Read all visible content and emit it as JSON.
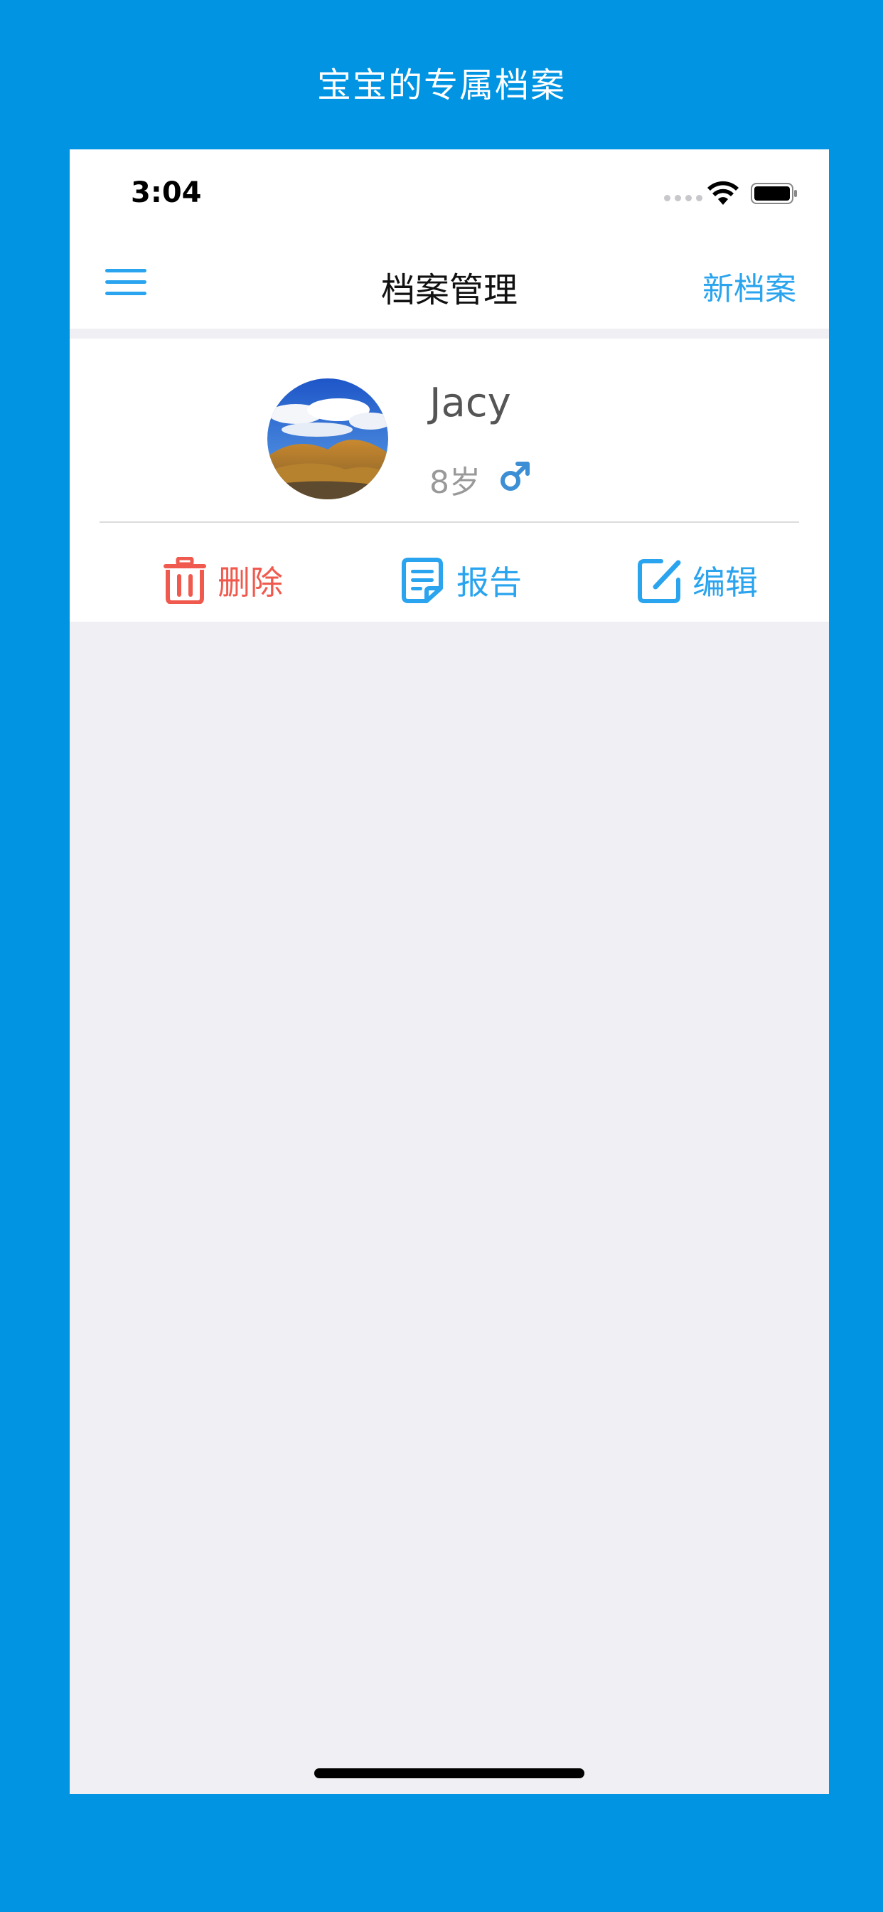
{
  "banner": {
    "title": "宝宝的专属档案"
  },
  "status_bar": {
    "time": "3:04"
  },
  "nav": {
    "title": "档案管理",
    "new_label": "新档案",
    "menu_icon": "hamburger-menu-icon"
  },
  "profile": {
    "name": "Jacy",
    "age": "8岁",
    "gender_icon": "male-icon"
  },
  "actions": {
    "delete_label": "删除",
    "report_label": "报告",
    "edit_label": "编辑"
  },
  "colors": {
    "background_blue": "#0094E2",
    "accent_blue": "#2AA4EE",
    "delete_red": "#F05A4E",
    "page_gray": "#EFEFF4"
  }
}
